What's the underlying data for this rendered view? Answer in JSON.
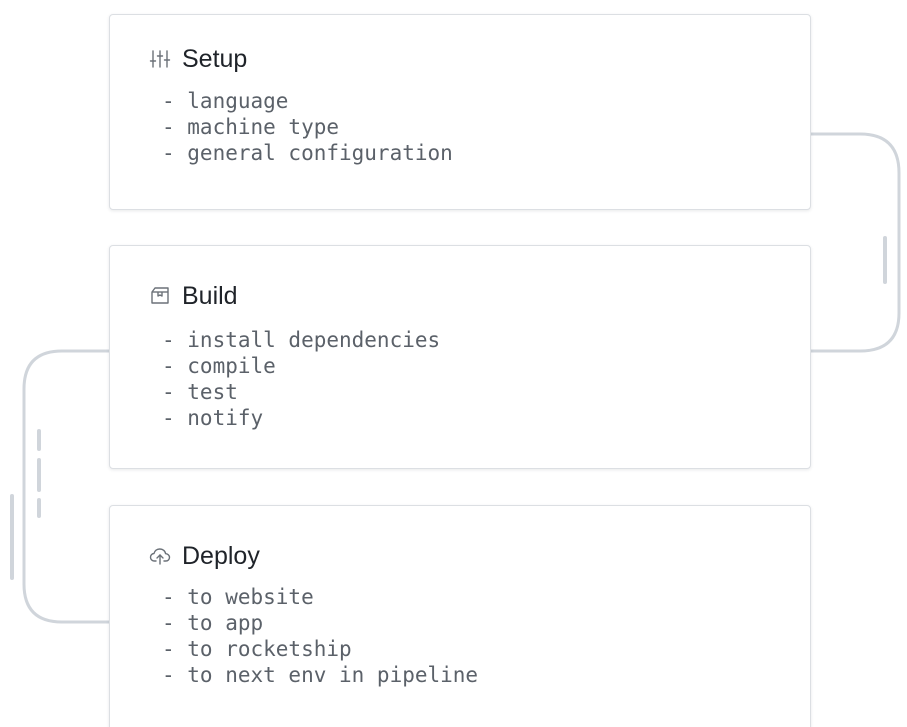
{
  "colors": {
    "connector": "#d0d5db",
    "card_border": "#dcdfe3",
    "title": "#1f2329",
    "step_text": "#5b6169",
    "icon": "#6b7178"
  },
  "stages": [
    {
      "title": "Setup",
      "icon": "sliders-icon",
      "steps": [
        "- language",
        "- machine type",
        "- general configuration"
      ]
    },
    {
      "title": "Build",
      "icon": "box-icon",
      "steps": [
        "- install dependencies",
        "- compile",
        "- test",
        "- notify"
      ]
    },
    {
      "title": "Deploy",
      "icon": "cloud-upload-icon",
      "steps": [
        "- to website",
        "- to app",
        "- to rocketship",
        "- to next env in pipeline"
      ]
    }
  ]
}
